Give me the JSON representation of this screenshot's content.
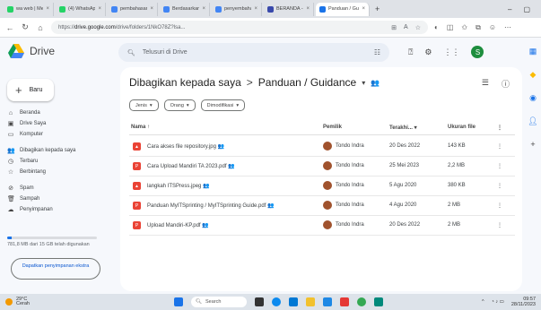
{
  "browser": {
    "tabs": [
      {
        "label": "wa web | Me",
        "color": "#25d366"
      },
      {
        "label": "(4) WhatsApp",
        "color": "#25d366"
      },
      {
        "label": "pembahasan",
        "color": "#4285f4"
      },
      {
        "label": "Berdasarkan",
        "color": "#4285f4"
      },
      {
        "label": "penyembahan",
        "color": "#4285f4"
      },
      {
        "label": "BERANDA - Pe",
        "color": "#3949ab"
      },
      {
        "label": "Panduan / Gui",
        "color": "#1a73e8"
      }
    ],
    "url_prefix": "https://",
    "url_host": "drive.google.com",
    "url_path": "/drive/folders/1NkO78Z?lsa...",
    "icons": [
      "back-icon",
      "forward-icon",
      "reload-icon"
    ]
  },
  "drive": {
    "app_name": "Drive",
    "search_placeholder": "Telusuri di Drive",
    "new_label": "Baru",
    "sidebar": [
      {
        "label": "Beranda",
        "icon": "⌂"
      },
      {
        "label": "Drive Saya",
        "icon": "▣"
      },
      {
        "label": "Komputer",
        "icon": "▭"
      },
      {
        "label": "Dibagikan kepada saya",
        "icon": "👥"
      },
      {
        "label": "Terbaru",
        "icon": "◷"
      },
      {
        "label": "Berbintang",
        "icon": "☆"
      },
      {
        "label": "Spam",
        "icon": "⊘"
      },
      {
        "label": "Sampah",
        "icon": "🗑"
      },
      {
        "label": "Penyimpanan",
        "icon": "☁"
      }
    ],
    "storage": {
      "text": "781,8 MB dari 15 GB telah digunakan",
      "fraction": 0.05
    },
    "get_more": "Dapatkan penyimpanan ekstra",
    "breadcrumb": {
      "root": "Dibagikan kepada saya",
      "sep": ">",
      "current": "Panduan / Guidance"
    },
    "filters": [
      "Jenis",
      "Orang",
      "Dimodifikasi"
    ],
    "columns": {
      "name": "Nama",
      "owner": "Pemilik",
      "modified": "Terakhi...",
      "size": "Ukuran file"
    },
    "files": [
      {
        "name": "Cara akses file repository.jpg",
        "owner": "Tondo Indra",
        "modified": "20 Des 2022",
        "size": "143 KB",
        "kind": "image"
      },
      {
        "name": "Cara Upload Mandiri TA 2023.pdf",
        "owner": "Tondo Indra",
        "modified": "25 Mei 2023",
        "size": "2,2 MB",
        "kind": "pdf"
      },
      {
        "name": "langkah ITSPress.jpeg",
        "owner": "Tondo Indra",
        "modified": "5 Agu 2020",
        "size": "380 KB",
        "kind": "image"
      },
      {
        "name": "Panduan MyITSprinting / MyITSprinting Guide.pdf",
        "owner": "Tondo Indra",
        "modified": "4 Agu 2020",
        "size": "2 MB",
        "kind": "pdf"
      },
      {
        "name": "Upload Mandiri-KP.pdf",
        "owner": "Tondo Indra",
        "modified": "20 Des 2022",
        "size": "2 MB",
        "kind": "pdf"
      }
    ],
    "file_colors": {
      "pdf": "#ea4335",
      "image": "#ea4335"
    }
  },
  "taskbar": {
    "weather_temp": "29°C",
    "weather_desc": "Cerah",
    "search": "Search",
    "time": "09:57",
    "date": "28/11/2023"
  }
}
